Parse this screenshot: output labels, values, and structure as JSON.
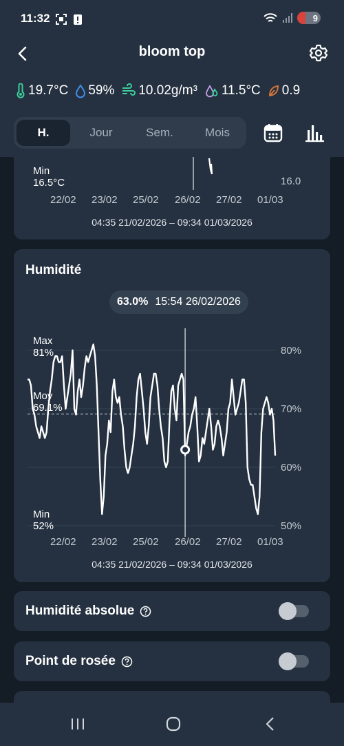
{
  "status_bar": {
    "time": "11:32",
    "battery_level": "9"
  },
  "header": {
    "title": "bloom top"
  },
  "metrics": [
    {
      "icon": "thermometer-icon",
      "value": "19.7°C"
    },
    {
      "icon": "droplet-icon",
      "value": "59%"
    },
    {
      "icon": "wind-humidity-icon",
      "value": "10.02g/m³"
    },
    {
      "icon": "dew-point-icon",
      "value": "11.5°C"
    },
    {
      "icon": "leaf-icon",
      "value": "0.9"
    }
  ],
  "range_tabs": [
    "H.",
    "Jour",
    "Sem.",
    "Mois"
  ],
  "active_tab": "H.",
  "temperature_card": {
    "min_label": "Min",
    "min_value": "16.5°C",
    "right_tick": "16.0",
    "x_ticks": [
      "22/02",
      "23/02",
      "25/02",
      "26/02",
      "27/02",
      "01/03"
    ],
    "range": "04:35 21/02/2026 – 09:34 01/03/2026"
  },
  "humidity_card": {
    "title": "Humidité",
    "tooltip_value": "63.0%",
    "tooltip_time": "15:54 26/02/2026",
    "max_label": "Max",
    "max_value": "81%",
    "avg_label": "Moy",
    "avg_value": "69.1%",
    "min_label": "Min",
    "min_value": "52%",
    "y_ticks": [
      "80%",
      "70%",
      "60%",
      "50%"
    ],
    "x_ticks": [
      "22/02",
      "23/02",
      "25/02",
      "26/02",
      "27/02",
      "01/03"
    ],
    "range": "04:35 21/02/2026 – 09:34 01/03/2026"
  },
  "chart_data": {
    "type": "line",
    "title": "Humidité",
    "xlabel": "",
    "ylabel": "",
    "ylim": [
      50,
      80
    ],
    "x_range": [
      "21/02/2026 04:35",
      "01/03/2026 09:34"
    ],
    "x_ticks": [
      "22/02",
      "23/02",
      "25/02",
      "26/02",
      "27/02",
      "01/03"
    ],
    "y_ticks": [
      80,
      70,
      60,
      50
    ],
    "average": 69.1,
    "max": 81,
    "min": 52,
    "selected_point": {
      "time": "15:54 26/02/2026",
      "value": 63.0
    },
    "series": [
      {
        "values": [
          75,
          75,
          74,
          70,
          69,
          67,
          66,
          65,
          67,
          66,
          65,
          66,
          70,
          73,
          75,
          78,
          79,
          79,
          78,
          78,
          79,
          74,
          70,
          72,
          74,
          76,
          80,
          70,
          69,
          73,
          75,
          72,
          74,
          77,
          79,
          78,
          79,
          80,
          81,
          79,
          74,
          66,
          58,
          52,
          55,
          62,
          64,
          68,
          66,
          73,
          75,
          72,
          71,
          72,
          69,
          67,
          63,
          60,
          59,
          60,
          62,
          64,
          67,
          72,
          75,
          76,
          73,
          70,
          66,
          64,
          67,
          72,
          74,
          76,
          76,
          74,
          70,
          67,
          65,
          61,
          60,
          61,
          68,
          73,
          74,
          70,
          68,
          74,
          75,
          76,
          75,
          62,
          64,
          66,
          67,
          69,
          70,
          72,
          67,
          61,
          62,
          65,
          64,
          66,
          68,
          70,
          67,
          63,
          64,
          67,
          68,
          67,
          65,
          62,
          64,
          66,
          70,
          71,
          75,
          72,
          69,
          70,
          71,
          73,
          75,
          75,
          71,
          60,
          58,
          57,
          57,
          55,
          53,
          52,
          55,
          66,
          70,
          71,
          72,
          71,
          69,
          70,
          68,
          62
        ]
      }
    ]
  },
  "toggles": [
    {
      "label": "Humidité absolue",
      "on": false
    },
    {
      "label": "Point de rosée",
      "on": false
    }
  ]
}
